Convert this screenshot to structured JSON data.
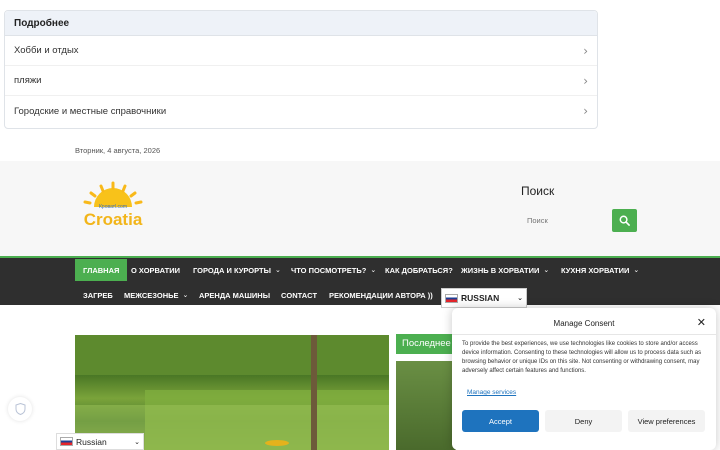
{
  "related": {
    "heading": "Подробнее",
    "items": [
      {
        "label": "Хобби и отдых"
      },
      {
        "label": "пляжи"
      },
      {
        "label": "Городские и местные справочники"
      }
    ]
  },
  "date": "Вторник, 4 августа, 2026",
  "logo": {
    "text": "Croatia",
    "subtext": "Кроватl.com"
  },
  "search": {
    "title": "Поиск",
    "placeholder": "Поиск"
  },
  "nav": {
    "row1": [
      {
        "label": "Главная",
        "dropdown": false
      },
      {
        "label": "О Хорватии",
        "dropdown": false
      },
      {
        "label": "Города и курорты",
        "dropdown": true
      },
      {
        "label": "Что посмотреть?",
        "dropdown": true
      },
      {
        "label": "Как добраться?",
        "dropdown": false
      },
      {
        "label": "Жизнь в Хорватии",
        "dropdown": true
      },
      {
        "label": "Кухня Хорватии",
        "dropdown": true
      }
    ],
    "row2": [
      {
        "label": "Загреб",
        "dropdown": false
      },
      {
        "label": "Межсезонье",
        "dropdown": true
      },
      {
        "label": "Аренда машины",
        "dropdown": false
      },
      {
        "label": "Contact",
        "dropdown": false
      },
      {
        "label": "Рекомендации автора ))",
        "dropdown": false
      }
    ],
    "language": "RUSSIAN"
  },
  "latest": {
    "tag": "Последнее"
  },
  "floating_language": "Russian",
  "consent": {
    "title": "Manage Consent",
    "body": "To provide the best experiences, we use technologies like cookies to store and/or access device information. Consenting to these technologies will allow us to process data such as browsing behavior or unique IDs on this site. Not consenting or withdrawing consent, may adversely affect certain features and functions.",
    "manage_link": "Manage services",
    "accept": "Accept",
    "deny": "Deny",
    "preferences": "View preferences"
  },
  "colors": {
    "accent": "#4caf50",
    "nav_bg": "#2f2f2f",
    "consent_blue": "#1e73be"
  }
}
